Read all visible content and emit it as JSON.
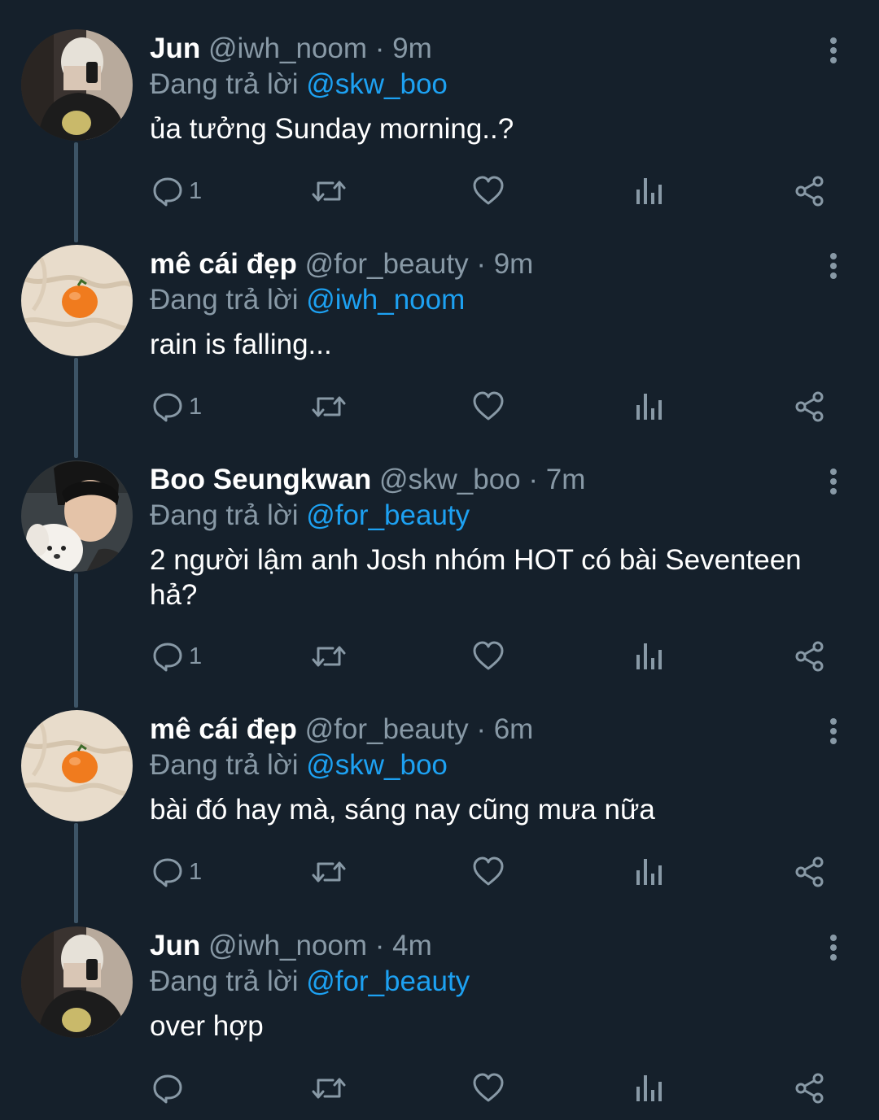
{
  "tweets": [
    {
      "name": "Jun",
      "handle": "@iwh_noom",
      "separator": "·",
      "time": "9m",
      "reply_prefix": "Đang trả lời",
      "reply_to": "@skw_boo",
      "text": "ủa tưởng Sunday morning..?",
      "reply_count": "1",
      "avatar": "avatar-jun"
    },
    {
      "name": "mê cái đẹp",
      "handle": "@for_beauty",
      "separator": "·",
      "time": "9m",
      "reply_prefix": "Đang trả lời",
      "reply_to": "@iwh_noom",
      "text": "rain is falling...",
      "reply_count": "1",
      "avatar": "avatar-orange"
    },
    {
      "name": "Boo Seungkwan",
      "handle": "@skw_boo",
      "separator": "·",
      "time": "7m",
      "reply_prefix": "Đang trả lời",
      "reply_to": "@for_beauty",
      "text": "2 người lậm anh Josh nhóm HOT có bài Seventeen hả?",
      "reply_count": "1",
      "avatar": "avatar-boo"
    },
    {
      "name": "mê cái đẹp",
      "handle": "@for_beauty",
      "separator": "·",
      "time": "6m",
      "reply_prefix": "Đang trả lời",
      "reply_to": "@skw_boo",
      "text": "bài đó hay mà, sáng nay cũng mưa nữa",
      "reply_count": "1",
      "avatar": "avatar-orange"
    },
    {
      "name": "Jun",
      "handle": "@iwh_noom",
      "separator": "·",
      "time": "4m",
      "reply_prefix": "Đang trả lời",
      "reply_to": "@for_beauty",
      "text": "over hợp",
      "reply_count": "",
      "avatar": "avatar-jun"
    }
  ],
  "icons": {
    "reply": "reply-bubble-icon",
    "retweet": "retweet-icon",
    "like": "heart-icon",
    "analytics": "analytics-bars-icon",
    "share": "share-icon",
    "more": "more-vertical-icon"
  },
  "colors": {
    "background": "#15202b",
    "text_primary": "#ffffff",
    "text_secondary": "#8899a6",
    "mention": "#1da1f2",
    "thread_line": "#3d5466"
  }
}
